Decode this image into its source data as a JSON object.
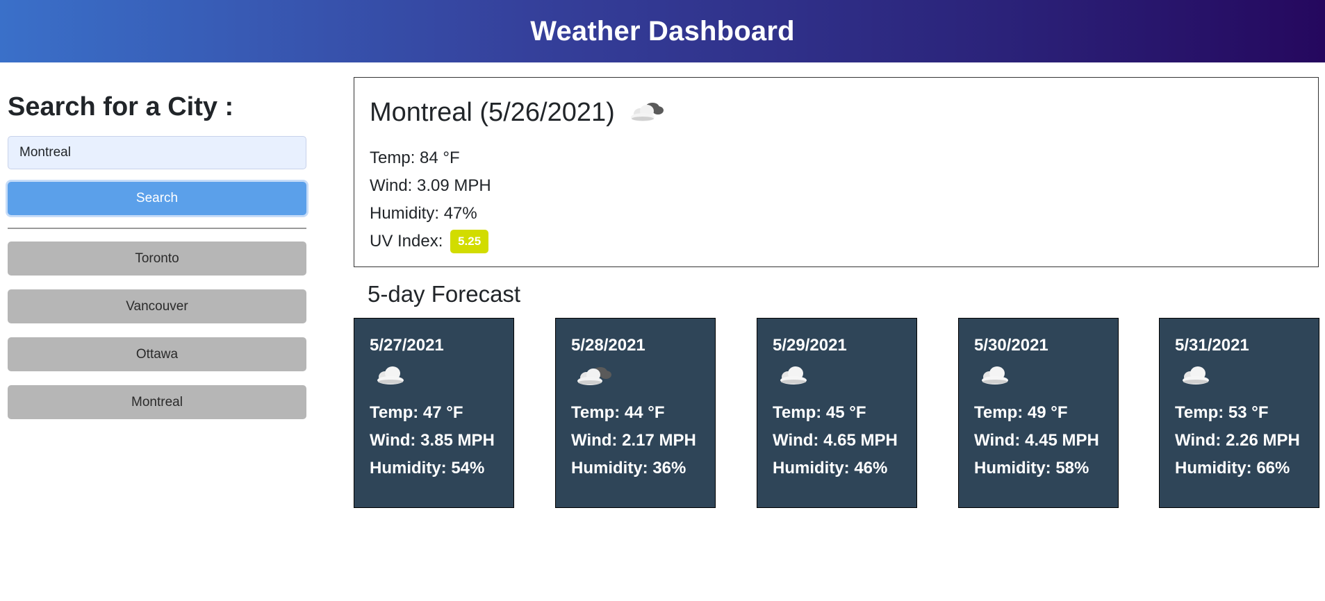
{
  "header": {
    "title": "Weather Dashboard"
  },
  "sidebar": {
    "heading": "Search for a City :",
    "search_value": "Montreal",
    "search_button": "Search",
    "history": [
      "Toronto",
      "Vancouver",
      "Ottawa",
      "Montreal"
    ]
  },
  "current": {
    "title": "Montreal (5/26/2021)",
    "icon": "partly-cloudy-icon",
    "temp": "Temp: 84 °F",
    "wind": "Wind: 3.09 MPH",
    "humidity": "Humidity: 47%",
    "uv_label": "UV Index:",
    "uv_value": "5.25",
    "uv_color": "#d2dc00"
  },
  "forecast": {
    "title": "5-day Forecast",
    "days": [
      {
        "date": "5/27/2021",
        "icon": "cloud-icon",
        "temp": "Temp: 47 °F",
        "wind": "Wind: 3.85 MPH",
        "humidity": "Humidity: 54%"
      },
      {
        "date": "5/28/2021",
        "icon": "partly-cloudy-icon",
        "temp": "Temp: 44 °F",
        "wind": "Wind: 2.17 MPH",
        "humidity": "Humidity: 36%"
      },
      {
        "date": "5/29/2021",
        "icon": "cloud-icon",
        "temp": "Temp: 45 °F",
        "wind": "Wind: 4.65 MPH",
        "humidity": "Humidity: 46%"
      },
      {
        "date": "5/30/2021",
        "icon": "cloud-icon",
        "temp": "Temp: 49 °F",
        "wind": "Wind: 4.45 MPH",
        "humidity": "Humidity: 58%"
      },
      {
        "date": "5/31/2021",
        "icon": "cloud-icon",
        "temp": "Temp: 53 °F",
        "wind": "Wind: 2.26 MPH",
        "humidity": "Humidity: 66%"
      }
    ]
  },
  "colors": {
    "header_start": "#3a70c9",
    "header_end": "#25085e",
    "search_button": "#5ba0ea",
    "history_button": "#b6b6b6",
    "card_background": "#2f4558"
  }
}
